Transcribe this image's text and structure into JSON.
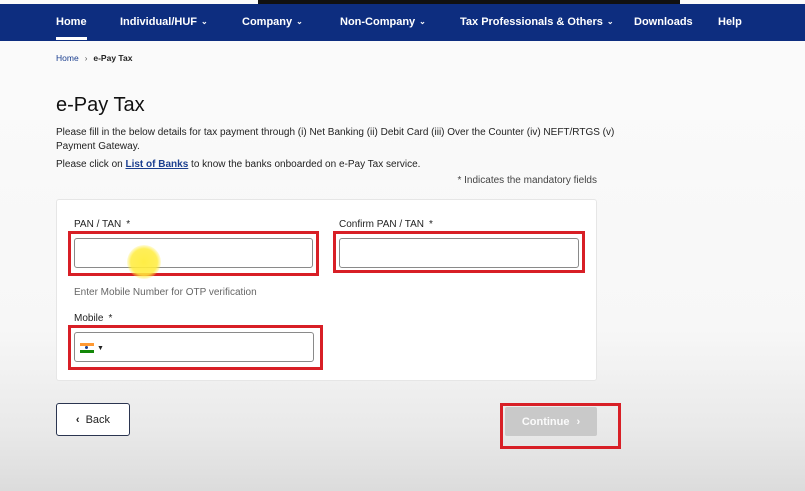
{
  "nav": {
    "items": [
      {
        "label": "Home",
        "dropdown": false
      },
      {
        "label": "Individual/HUF",
        "dropdown": true
      },
      {
        "label": "Company",
        "dropdown": true
      },
      {
        "label": "Non-Company",
        "dropdown": true
      },
      {
        "label": "Tax Professionals & Others",
        "dropdown": true
      },
      {
        "label": "Downloads",
        "dropdown": false
      },
      {
        "label": "Help",
        "dropdown": false
      }
    ]
  },
  "breadcrumb": {
    "home": "Home",
    "current": "e-Pay Tax"
  },
  "page": {
    "title": "e-Pay Tax",
    "description": "Please fill in the below details for tax payment through (i) Net Banking (ii) Debit Card (iii) Over the Counter (iv) NEFT/RTGS (v) Payment Gateway.",
    "banks_prefix": "Please click on ",
    "banks_link": "List of Banks",
    "banks_suffix": " to know the banks onboarded on e-Pay Tax service.",
    "mandatory_note": "* Indicates the mandatory fields"
  },
  "form": {
    "pan_label": "PAN / TAN",
    "pan_value": "",
    "confirm_pan_label": "Confirm PAN / TAN",
    "confirm_pan_value": "",
    "required_mark": "*",
    "mobile_hint": "Enter Mobile Number for OTP verification",
    "mobile_label": "Mobile",
    "mobile_value": ""
  },
  "buttons": {
    "back": "Back",
    "continue": "Continue"
  },
  "colors": {
    "nav_bg": "#0d2d7f",
    "highlight": "#d81f26",
    "link": "#1a3e8f",
    "disabled_button": "#c9c9c9"
  },
  "icons": {
    "nav_dropdown": "chevron-down-icon",
    "breadcrumb_sep": "chevron-right-icon",
    "back": "chevron-left-icon",
    "continue": "chevron-right-icon",
    "country": "india-flag-icon"
  }
}
